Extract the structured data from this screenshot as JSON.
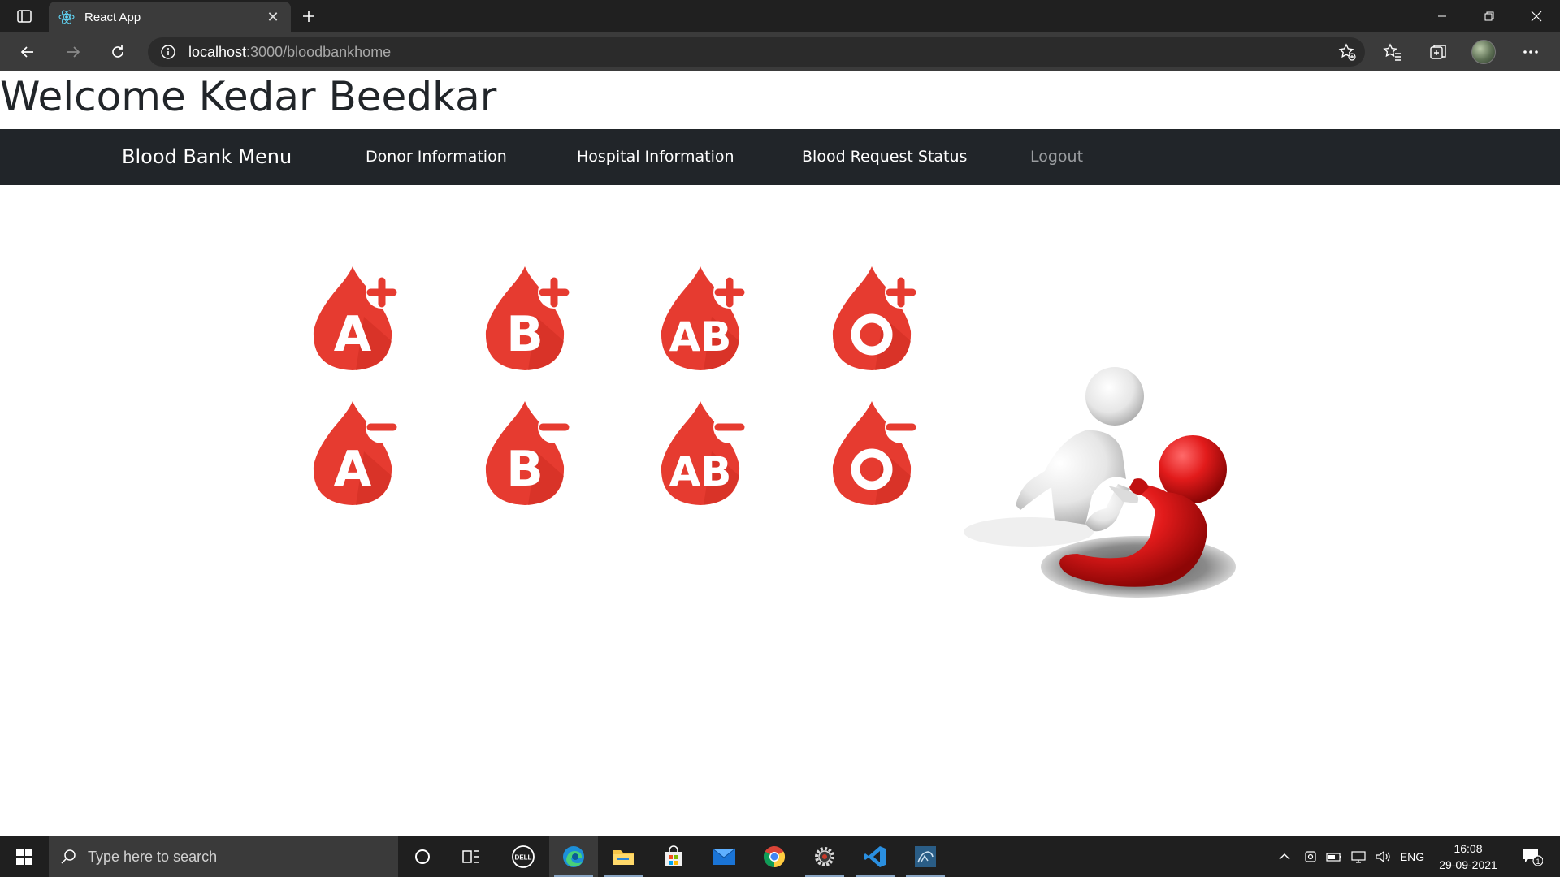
{
  "browser": {
    "tab_title": "React App",
    "url_host": "localhost",
    "url_path": ":3000/bloodbankhome"
  },
  "page": {
    "welcome": "Welcome Kedar Beedkar",
    "nav": {
      "brand": "Blood Bank Menu",
      "links": [
        "Donor Information",
        "Hospital Information",
        "Blood Request Status",
        "Logout"
      ]
    },
    "blood_groups": [
      {
        "label": "A",
        "sign": "+"
      },
      {
        "label": "B",
        "sign": "+"
      },
      {
        "label": "AB",
        "sign": "+"
      },
      {
        "label": "O",
        "sign": "+"
      },
      {
        "label": "A",
        "sign": "-"
      },
      {
        "label": "B",
        "sign": "-"
      },
      {
        "label": "AB",
        "sign": "-"
      },
      {
        "label": "O",
        "sign": "-"
      }
    ],
    "accent_red": "#e63b30"
  },
  "taskbar": {
    "search_placeholder": "Type here to search",
    "language": "ENG",
    "time": "16:08",
    "date": "29-09-2021",
    "notification_count": "1",
    "apps": [
      "cortana-icon",
      "task-view-icon",
      "dell-icon",
      "edge-icon",
      "file-explorer-icon",
      "store-icon",
      "mail-icon",
      "chrome-icon",
      "settings-gear-icon",
      "vscode-icon",
      "mysql-workbench-icon"
    ]
  }
}
